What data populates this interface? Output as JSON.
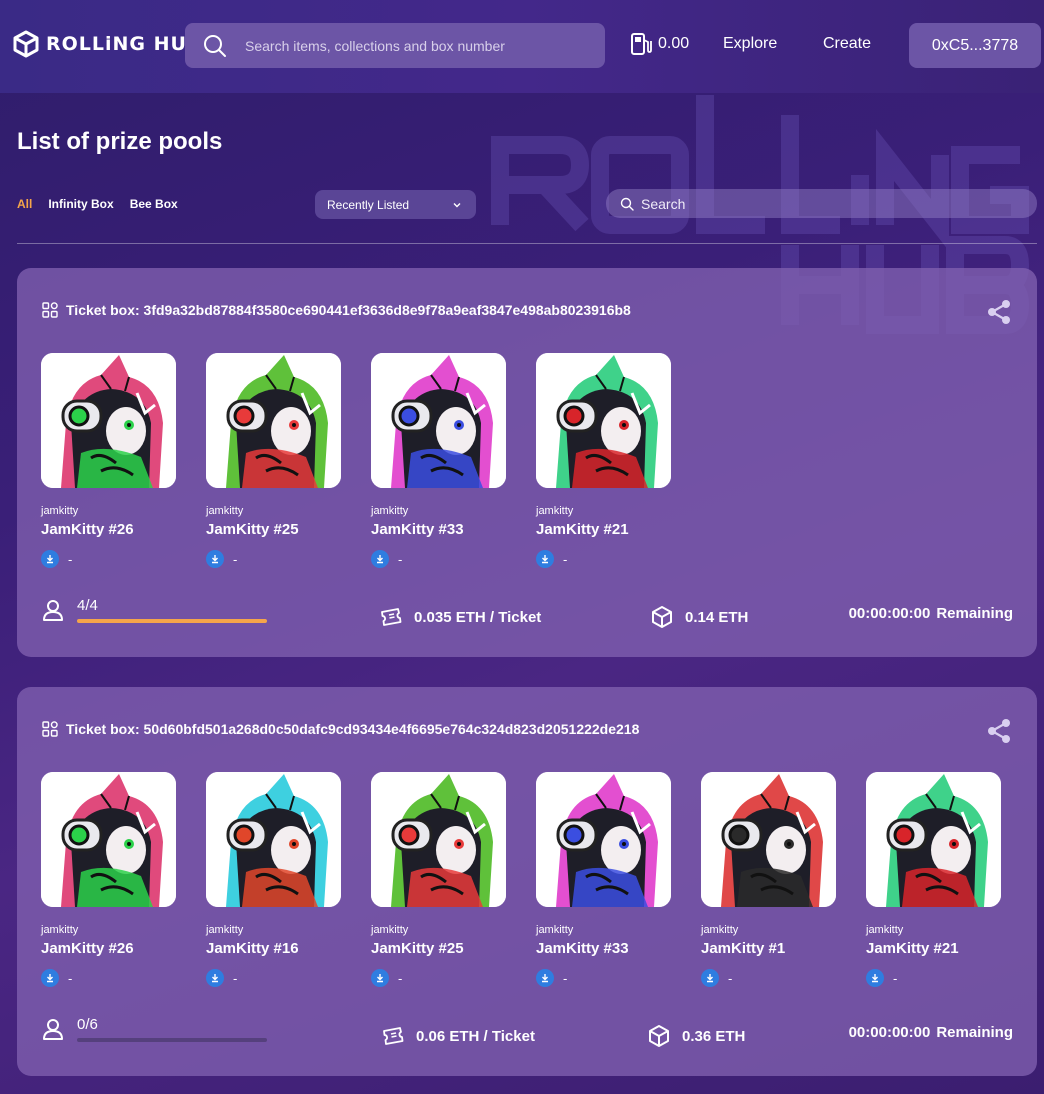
{
  "header": {
    "logo_text": "ROLLiNG HUB",
    "search_placeholder": "Search items, collections and box number",
    "gas_value": "0.00",
    "nav_explore": "Explore",
    "nav_create": "Create",
    "wallet_address": "0xC5...3778"
  },
  "page": {
    "title": "List of prize pools",
    "filters": [
      "All",
      "Infinity Box",
      "Bee Box"
    ],
    "active_filter": "All",
    "sort_selected": "Recently Listed",
    "search_placeholder": "Search",
    "watermark_text": "ROLLiNG HUB"
  },
  "colors": {
    "accent": "#f5a54a",
    "card_bg": "#8060b0",
    "header_bg": "#3a2a86",
    "coin": "#2f7de0"
  },
  "pools": [
    {
      "box_label": "Ticket box: 3fd9a32bd87884f3580ce690441ef3636d8e9f78a9eaf3847e498ab8023916b8",
      "nfts": [
        {
          "collection": "jamkitty",
          "name": "JamKitty #26",
          "price": "-",
          "hood": "#e04a7c",
          "accent": "#2bd14a"
        },
        {
          "collection": "jamkitty",
          "name": "JamKitty #25",
          "price": "-",
          "hood": "#5fc13a",
          "accent": "#e83a3a"
        },
        {
          "collection": "jamkitty",
          "name": "JamKitty #33",
          "price": "-",
          "hood": "#e34fd0",
          "accent": "#3b4ee0"
        },
        {
          "collection": "jamkitty",
          "name": "JamKitty #21",
          "price": "-",
          "hood": "#3fd28a",
          "accent": "#d8242a"
        }
      ],
      "participants": "4/4",
      "progress": 1.0,
      "ticket_price": "0.035 ETH / Ticket",
      "total": "0.14 ETH",
      "remaining_time": "00:00:00:00",
      "remaining_label": "Remaining"
    },
    {
      "box_label": "Ticket box: 50d60bfd501a268d0c50dafc9cd93434e4f6695e764c324d823d2051222de218",
      "nfts": [
        {
          "collection": "jamkitty",
          "name": "JamKitty #26",
          "price": "-",
          "hood": "#e04a7c",
          "accent": "#2bd14a"
        },
        {
          "collection": "jamkitty",
          "name": "JamKitty #16",
          "price": "-",
          "hood": "#3ed0e0",
          "accent": "#e0462a"
        },
        {
          "collection": "jamkitty",
          "name": "JamKitty #25",
          "price": "-",
          "hood": "#5fc13a",
          "accent": "#e83a3a"
        },
        {
          "collection": "jamkitty",
          "name": "JamKitty #33",
          "price": "-",
          "hood": "#e34fd0",
          "accent": "#3b4ee0"
        },
        {
          "collection": "jamkitty",
          "name": "JamKitty #1",
          "price": "-",
          "hood": "#e04848",
          "accent": "#2a2a2a"
        },
        {
          "collection": "jamkitty",
          "name": "JamKitty #21",
          "price": "-",
          "hood": "#3fd28a",
          "accent": "#d8242a"
        }
      ],
      "participants": "0/6",
      "progress": 0.0,
      "ticket_price": "0.06 ETH / Ticket",
      "total": "0.36 ETH",
      "remaining_time": "00:00:00:00",
      "remaining_label": "Remaining"
    }
  ]
}
